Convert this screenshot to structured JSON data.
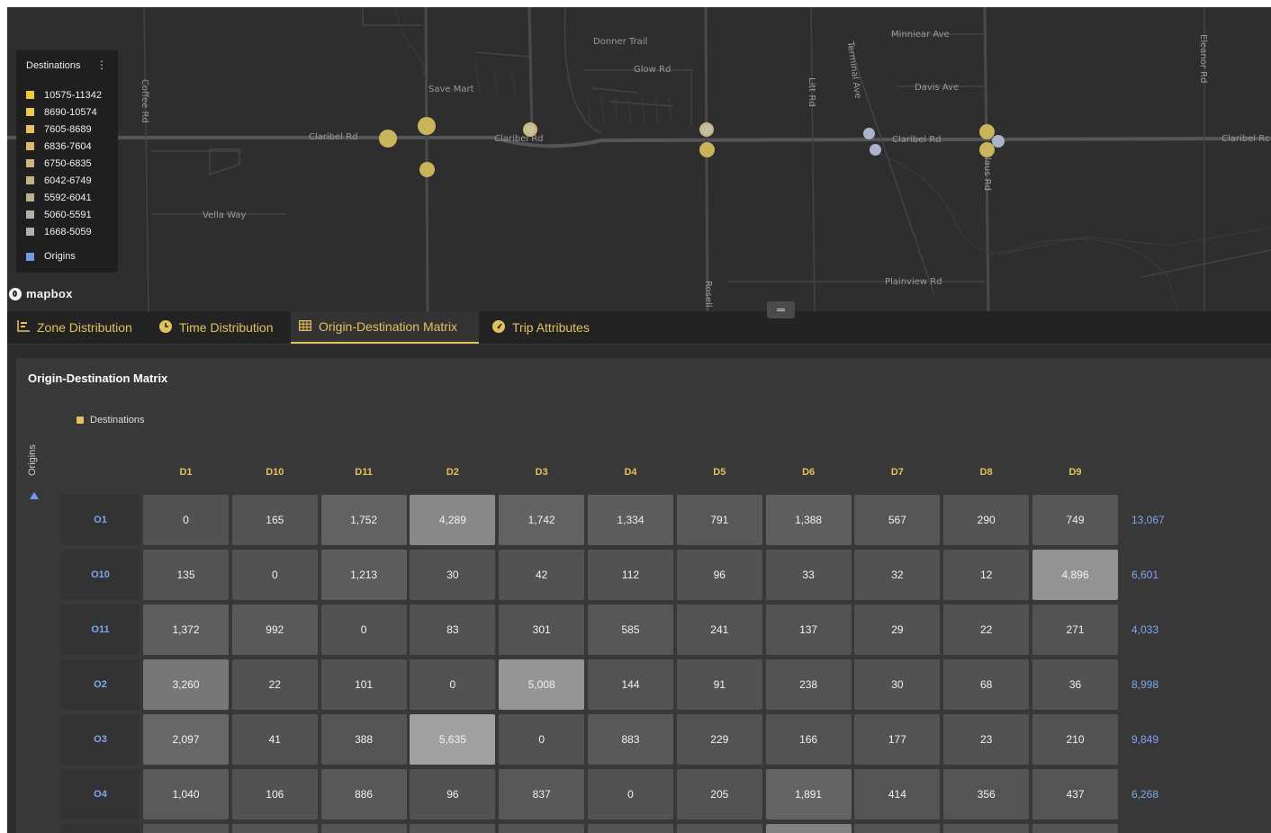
{
  "map": {
    "streets": {
      "claribel_1": "Claribel Rd",
      "claribel_2": "Claribel Rd",
      "claribel_3": "Claribel Rd",
      "claribel_4": "Claribel Rc",
      "coffee": "Coffee Rd",
      "vella": "Vella Way",
      "save_mart": "Save Mart",
      "donner": "Donner Trail",
      "glow": "Glow Rd",
      "litt": "Litt Rd",
      "terminal": "Terminal Ave",
      "minniear": "Minniear Ave",
      "davis": "Davis Ave",
      "eleanor": "Eleanor Rd",
      "claus": "Claus Rd",
      "plainview": "Plainview Rd",
      "rosell": "Rosell"
    },
    "logo_text": "mapbox",
    "resize_handle_glyph": "═"
  },
  "legend": {
    "title": "Destinations",
    "menu_icon": "⋮",
    "items": [
      {
        "label": "10575-11342",
        "color": "#f0c83c"
      },
      {
        "label": "8690-10574",
        "color": "#ecc84e"
      },
      {
        "label": "7605-8689",
        "color": "#e2c462"
      },
      {
        "label": "6836-7604",
        "color": "#d9bd6f"
      },
      {
        "label": "6750-6835",
        "color": "#ccb77c"
      },
      {
        "label": "6042-6749",
        "color": "#c2b387"
      },
      {
        "label": "5592-6041",
        "color": "#b9b095"
      },
      {
        "label": "5060-5591",
        "color": "#b3b0a4"
      },
      {
        "label": "1668-5059",
        "color": "#b0b0b0"
      }
    ],
    "origins_label": "Origins",
    "origins_color": "#6f9be8"
  },
  "tabs": [
    {
      "label": "Zone Distribution",
      "icon": "bar-chart-icon"
    },
    {
      "label": "Time Distribution",
      "icon": "clock-icon"
    },
    {
      "label": "Origin-Destination Matrix",
      "icon": "table-icon",
      "active": true
    },
    {
      "label": "Trip Attributes",
      "icon": "gauge-icon"
    }
  ],
  "panel": {
    "title": "Origin-Destination Matrix",
    "destinations_legend": "Destinations",
    "origins_axis": "Origins"
  },
  "matrix": {
    "columns": [
      "D1",
      "D10",
      "D11",
      "D2",
      "D3",
      "D4",
      "D5",
      "D6",
      "D7",
      "D8",
      "D9"
    ],
    "rows": [
      {
        "origin": "O1",
        "values": [
          "0",
          "165",
          "1,752",
          "4,289",
          "1,742",
          "1,334",
          "791",
          "1,388",
          "567",
          "290",
          "749"
        ],
        "total": "13,067"
      },
      {
        "origin": "O10",
        "values": [
          "135",
          "0",
          "1,213",
          "30",
          "42",
          "112",
          "96",
          "33",
          "32",
          "12",
          "4,896"
        ],
        "total": "6,601"
      },
      {
        "origin": "O11",
        "values": [
          "1,372",
          "992",
          "0",
          "83",
          "301",
          "585",
          "241",
          "137",
          "29",
          "22",
          "271"
        ],
        "total": "4,033"
      },
      {
        "origin": "O2",
        "values": [
          "3,260",
          "22",
          "101",
          "0",
          "5,008",
          "144",
          "91",
          "238",
          "30",
          "68",
          "36"
        ],
        "total": "8,998"
      },
      {
        "origin": "O3",
        "values": [
          "2,097",
          "41",
          "388",
          "5,635",
          "0",
          "883",
          "229",
          "166",
          "177",
          "23",
          "210"
        ],
        "total": "9,849"
      },
      {
        "origin": "O4",
        "values": [
          "1,040",
          "106",
          "886",
          "96",
          "837",
          "0",
          "205",
          "1,891",
          "414",
          "356",
          "437"
        ],
        "total": "6,268"
      }
    ]
  }
}
